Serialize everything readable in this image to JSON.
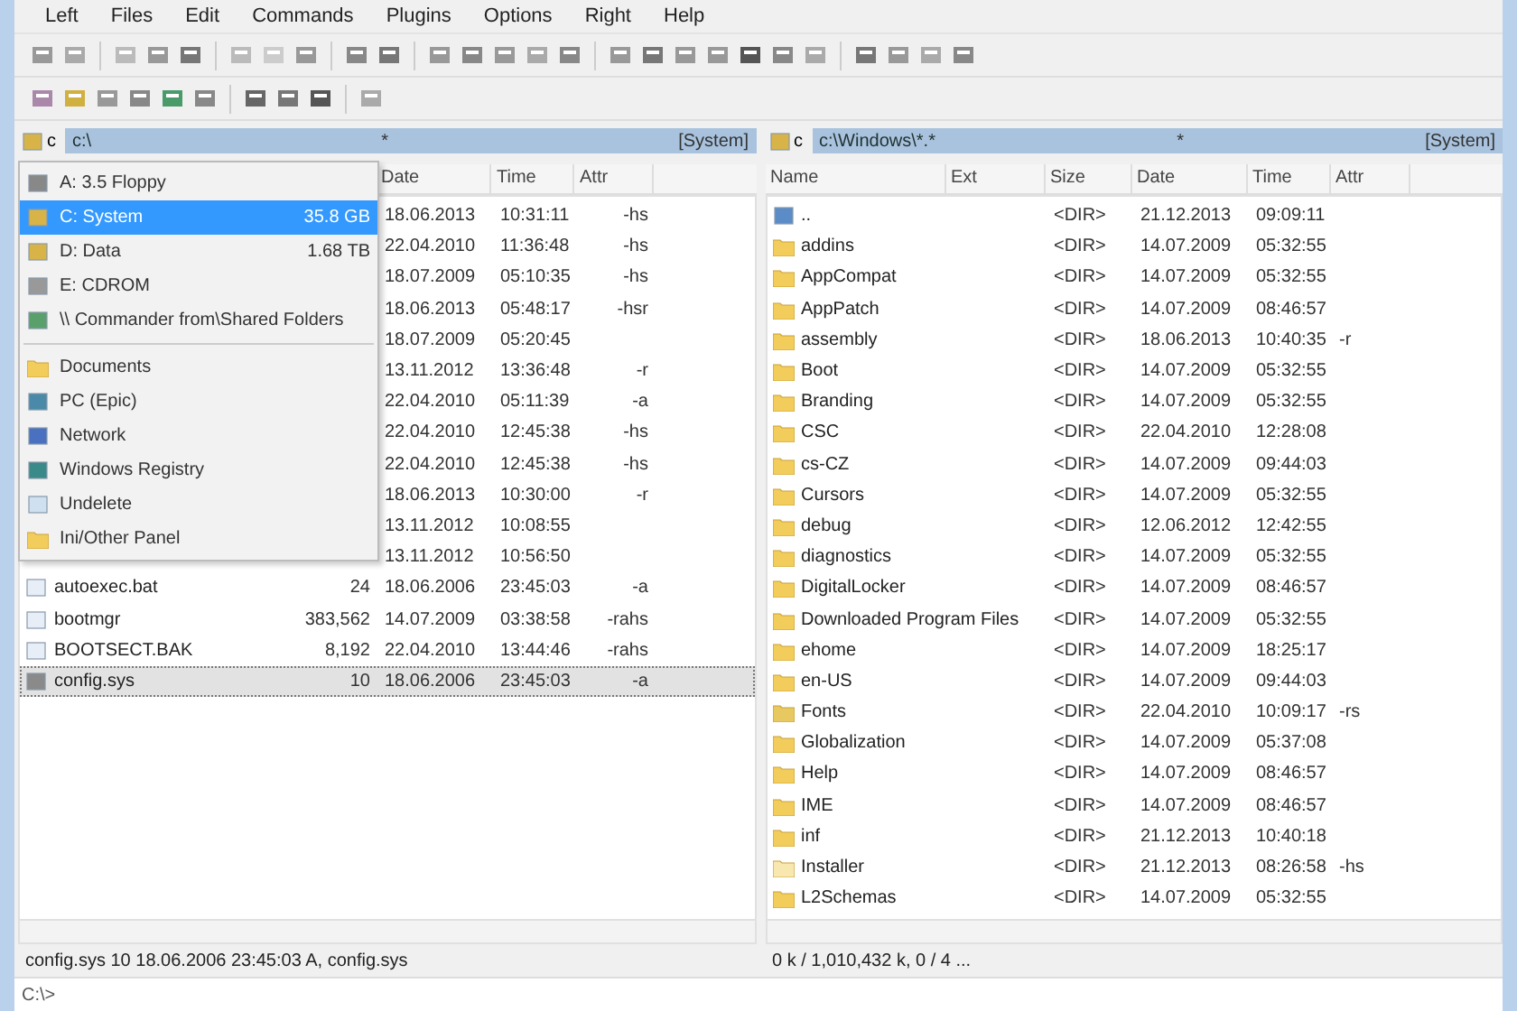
{
  "menu": [
    "Left",
    "Files",
    "Edit",
    "Commands",
    "Plugins",
    "Options",
    "Right",
    "Help"
  ],
  "left_panel": {
    "drive": "c",
    "path": "c:\\",
    "hotlist": "*",
    "info": "[System]",
    "columns": [
      "Date",
      "Time",
      "Attr"
    ],
    "rows": [
      {
        "kind": "hidden",
        "date": "18.06.2013",
        "time": "10:31:11",
        "attr": "-hs",
        "selected": false
      },
      {
        "kind": "hidden",
        "date": "22.04.2010",
        "time": "11:36:48",
        "attr": "-hs",
        "selected": false
      },
      {
        "kind": "hidden",
        "date": "18.07.2009",
        "time": "05:10:35",
        "attr": "-hs",
        "selected": false
      },
      {
        "kind": "hidden",
        "date": "18.06.2013",
        "time": "05:48:17",
        "attr": "-hsr",
        "selected": false
      },
      {
        "kind": "hidden",
        "date": "18.07.2009",
        "time": "05:20:45",
        "selected": false
      },
      {
        "kind": "hidden",
        "date": "13.11.2012",
        "time": "13:36:48",
        "attr": "-r",
        "selected": false
      },
      {
        "kind": "hidden",
        "date": "22.04.2010",
        "time": "05:11:39",
        "attr": "-a",
        "selected": false
      },
      {
        "kind": "hidden",
        "date": "22.04.2010",
        "time": "12:45:38",
        "attr": "-hs",
        "selected": false
      },
      {
        "kind": "hidden",
        "date": "22.04.2010",
        "time": "12:45:38",
        "attr": "-hs",
        "selected": false
      },
      {
        "kind": "hidden",
        "date": "18.06.2013",
        "time": "10:30:00",
        "attr": "-r",
        "selected": false
      },
      {
        "kind": "hidden",
        "date": "13.11.2012",
        "time": "10:08:55",
        "selected": false
      },
      {
        "kind": "hidden",
        "date": "13.11.2012",
        "time": "10:56:50",
        "selected": false
      },
      {
        "kind": "file",
        "name": "autoexec.bat",
        "size": "24",
        "date": "18.06.2006",
        "time": "23:45:03",
        "attr": "-a",
        "selected": false
      },
      {
        "kind": "file",
        "name": "bootmgr",
        "size": "383,562",
        "date": "14.07.2009",
        "time": "03:38:58",
        "attr": "-rahs",
        "selected": false
      },
      {
        "kind": "file",
        "name": "BOOTSECT.BAK",
        "size": "8,192",
        "date": "22.04.2010",
        "time": "13:44:46",
        "attr": "-rahs",
        "selected": false
      },
      {
        "kind": "sysfile",
        "name": "config.sys",
        "size": "10",
        "date": "18.06.2006",
        "time": "23:45:03",
        "attr": "-a",
        "selected": true
      }
    ],
    "status": "config.sys 10 18.06.2006 23:45:03 A, config.sys"
  },
  "drive_menu": [
    {
      "kind": "floppy",
      "label": "A: 3.5 Floppy",
      "selected": false
    },
    {
      "kind": "disk",
      "label": "C: System",
      "size": "35.8 GB",
      "selected": true
    },
    {
      "kind": "disk",
      "label": "D: Data",
      "size": "1.68 TB",
      "selected": false
    },
    {
      "kind": "cdrom",
      "label": "E: CDROM",
      "selected": false
    },
    {
      "kind": "share",
      "label": "\\\\ Commander from\\Shared Folders",
      "selected": false
    },
    {
      "kind": "separator"
    },
    {
      "kind": "folder",
      "label": "Documents",
      "selected": false
    },
    {
      "kind": "pc",
      "label": "PC (Epic)",
      "selected": false
    },
    {
      "kind": "network",
      "label": "Network",
      "selected": false
    },
    {
      "kind": "registry",
      "label": "Windows Registry",
      "selected": false
    },
    {
      "kind": "blank",
      "label": "Undelete",
      "selected": false
    },
    {
      "kind": "folder",
      "label": "Ini/Other Panel",
      "selected": false
    }
  ],
  "right_panel": {
    "drive": "c",
    "path": "c:\\Windows\\*.*",
    "hotlist": "*",
    "info": "[System]",
    "columns": [
      "Name",
      "Ext",
      "Size",
      "Date",
      "Time",
      "Attr"
    ],
    "rows": [
      {
        "kind": "up",
        "name": "..",
        "size": "<DIR>",
        "date": "21.12.2013",
        "time": "09:09:11"
      },
      {
        "kind": "folder",
        "name": "addins",
        "size": "<DIR>",
        "date": "14.07.2009",
        "time": "05:32:55"
      },
      {
        "kind": "folder",
        "name": "AppCompat",
        "size": "<DIR>",
        "date": "14.07.2009",
        "time": "05:32:55"
      },
      {
        "kind": "folder",
        "name": "AppPatch",
        "size": "<DIR>",
        "date": "14.07.2009",
        "time": "08:46:57"
      },
      {
        "kind": "folder",
        "name": "assembly",
        "size": "<DIR>",
        "date": "18.06.2013",
        "time": "10:40:35",
        "attr": "-r"
      },
      {
        "kind": "folder",
        "name": "Boot",
        "size": "<DIR>",
        "date": "14.07.2009",
        "time": "05:32:55"
      },
      {
        "kind": "folder",
        "name": "Branding",
        "size": "<DIR>",
        "date": "14.07.2009",
        "time": "05:32:55"
      },
      {
        "kind": "folder",
        "name": "CSC",
        "size": "<DIR>",
        "date": "22.04.2010",
        "time": "12:28:08"
      },
      {
        "kind": "folder",
        "name": "cs-CZ",
        "size": "<DIR>",
        "date": "14.07.2009",
        "time": "09:44:03"
      },
      {
        "kind": "folder",
        "name": "Cursors",
        "size": "<DIR>",
        "date": "14.07.2009",
        "time": "05:32:55"
      },
      {
        "kind": "folder",
        "name": "debug",
        "size": "<DIR>",
        "date": "12.06.2012",
        "time": "12:42:55"
      },
      {
        "kind": "folder",
        "name": "diagnostics",
        "size": "<DIR>",
        "date": "14.07.2009",
        "time": "05:32:55"
      },
      {
        "kind": "folder",
        "name": "DigitalLocker",
        "size": "<DIR>",
        "date": "14.07.2009",
        "time": "08:46:57"
      },
      {
        "kind": "folder",
        "name": "Downloaded Program Files",
        "size": "<DIR>",
        "date": "14.07.2009",
        "time": "05:32:55"
      },
      {
        "kind": "folder",
        "name": "ehome",
        "size": "<DIR>",
        "date": "14.07.2009",
        "time": "18:25:17"
      },
      {
        "kind": "folder",
        "name": "en-US",
        "size": "<DIR>",
        "date": "14.07.2009",
        "time": "09:44:03"
      },
      {
        "kind": "fontfolder",
        "name": "Fonts",
        "size": "<DIR>",
        "date": "22.04.2010",
        "time": "10:09:17",
        "attr": "-rs"
      },
      {
        "kind": "folder",
        "name": "Globalization",
        "size": "<DIR>",
        "date": "14.07.2009",
        "time": "05:37:08"
      },
      {
        "kind": "folder",
        "name": "Help",
        "size": "<DIR>",
        "date": "14.07.2009",
        "time": "08:46:57"
      },
      {
        "kind": "folder",
        "name": "IME",
        "size": "<DIR>",
        "date": "14.07.2009",
        "time": "08:46:57"
      },
      {
        "kind": "folder",
        "name": "inf",
        "size": "<DIR>",
        "date": "21.12.2013",
        "time": "10:40:18"
      },
      {
        "kind": "lightfolder",
        "name": "Installer",
        "size": "<DIR>",
        "date": "21.12.2013",
        "time": "08:26:58",
        "attr": "-hs"
      },
      {
        "kind": "folder",
        "name": "L2Schemas",
        "size": "<DIR>",
        "date": "14.07.2009",
        "time": "05:32:55"
      }
    ],
    "status": "0 k / 1,010,432 k, 0 / 4 ..."
  },
  "command_line": "C:\\>"
}
